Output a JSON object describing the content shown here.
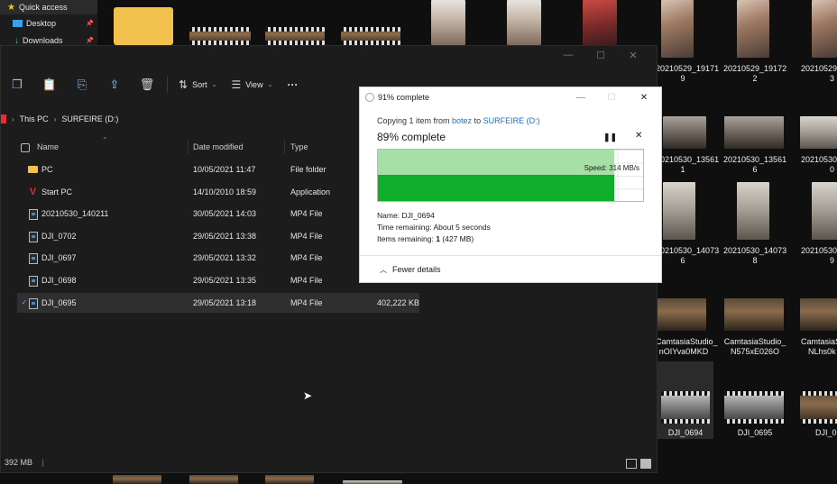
{
  "quick_access": {
    "items": [
      {
        "label": "Quick access",
        "icon": "star-icon"
      },
      {
        "label": "Desktop",
        "icon": "desktop-icon"
      },
      {
        "label": "Downloads",
        "icon": "download-icon"
      }
    ]
  },
  "desktop_labels": {
    "r1c1a": "20210529_19171",
    "r1c1b": "9",
    "r1c2a": "20210529_19172",
    "r1c2b": "2",
    "r1c3a": "20210529_1917",
    "r1c3b": "3",
    "r2c1a": "20210530_13561",
    "r2c1b": "1",
    "r2c2a": "20210530_13561",
    "r2c2b": "6",
    "r2c3a": "20210530_1356",
    "r2c3b": "0",
    "r3c1a": "20210530_14073",
    "r3c1b": "6",
    "r3c2a": "20210530_14073",
    "r3c2b": "8",
    "r3c3a": "20210530_1407",
    "r3c3b": "9",
    "r4c1a": "CamtasiaStudio_",
    "r4c1b": "nOIYva0MKD",
    "r4c2a": "CamtasiaStudio_",
    "r4c2b": "N575xE026O",
    "r4c3a": "CamtasiaS",
    "r4c3b": "NLhs0k",
    "r5c1": "DJI_0694",
    "r5c2": "DJI_0695",
    "r5c3": "DJI_0"
  },
  "toolbar": {
    "sort_label": "Sort",
    "view_label": "View",
    "more_label": "···"
  },
  "address": {
    "crumbs": [
      "This PC",
      "SURFEIRE (D:)"
    ]
  },
  "columns": {
    "name": "Name",
    "date": "Date modified",
    "type": "Type"
  },
  "files": [
    {
      "name": "PC",
      "date": "10/05/2021 11:47",
      "type": "File folder",
      "size": "",
      "kind": "folder"
    },
    {
      "name": "Start PC",
      "date": "14/10/2010 18:59",
      "type": "Application",
      "size": "",
      "kind": "app"
    },
    {
      "name": "20210530_140211",
      "date": "30/05/2021 14:03",
      "type": "MP4 File",
      "size": "",
      "kind": "mp4"
    },
    {
      "name": "DJI_0702",
      "date": "29/05/2021 13:38",
      "type": "MP4 File",
      "size": "",
      "kind": "mp4"
    },
    {
      "name": "DJI_0697",
      "date": "29/05/2021 13:32",
      "type": "MP4 File",
      "size": "",
      "kind": "mp4"
    },
    {
      "name": "DJI_0698",
      "date": "29/05/2021 13:35",
      "type": "MP4 File",
      "size": "",
      "kind": "mp4"
    },
    {
      "name": "DJI_0695",
      "date": "29/05/2021 13:18",
      "type": "MP4 File",
      "size": "402,222 KB",
      "kind": "mp4"
    }
  ],
  "statusbar": {
    "text": "392 MB",
    "sep": "|"
  },
  "dialog": {
    "title": "91% complete",
    "copying_prefix": "Copying 1 item from ",
    "source": "botez",
    "to": " to ",
    "destination": "SURFEIRE (D:)",
    "percent_label": "89% complete",
    "progress": 0.89,
    "speed": "Speed: 314 MB/s",
    "name_label": "Name: ",
    "name_value": "DJI_0694",
    "time_label": "Time remaining: ",
    "time_value": "About 5 seconds",
    "items_label": "Items remaining: ",
    "items_count": "1",
    "items_size": " (427 MB)",
    "fewer_details": "Fewer details",
    "pause_icon": "pause-icon",
    "cancel_icon": "close-icon"
  }
}
